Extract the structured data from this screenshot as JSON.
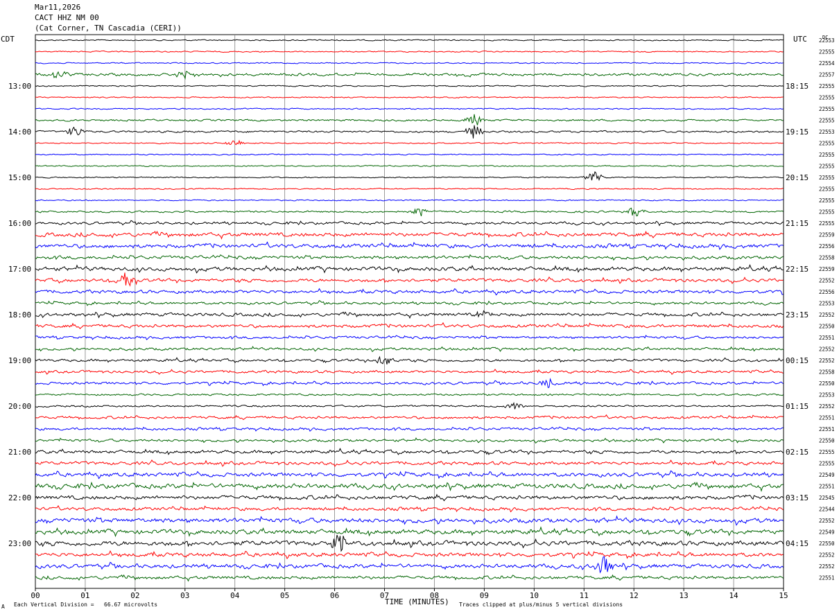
{
  "header": {
    "date": "Mar11,2026",
    "station": "CACT HHZ NM 00",
    "location": "(Cat Corner, TN Cascadia (CERI))"
  },
  "left_tz": "CDT",
  "right_tz": "UTC",
  "dc_label": "DC",
  "footer": {
    "scale": "Each Vertical Division =   66.67 microvolts",
    "xlabel": "TIME (MINUTES)",
    "clip_note": "Traces clipped at plus/minus 5 vertical divisions",
    "corner_mark": "A"
  },
  "colors": {
    "trace_cycle": [
      "#000000",
      "#ff0000",
      "#0000ff",
      "#006400"
    ],
    "grid": "#808080"
  },
  "chart_data": {
    "type": "line",
    "title": "CACT HHZ NM 00",
    "xlabel": "TIME (MINUTES)",
    "xlim": [
      0,
      15
    ],
    "x_ticks": [
      "00",
      "01",
      "02",
      "03",
      "04",
      "05",
      "06",
      "07",
      "08",
      "09",
      "10",
      "11",
      "12",
      "13",
      "14",
      "15"
    ],
    "left_hour_labels": [
      "13:00",
      "14:00",
      "15:00",
      "16:00",
      "17:00",
      "18:00",
      "19:00",
      "20:00",
      "21:00",
      "22:00",
      "23:00"
    ],
    "right_hour_labels": [
      "18:15",
      "19:15",
      "20:15",
      "21:15",
      "22:15",
      "23:15",
      "00:15",
      "01:15",
      "02:15",
      "03:15",
      "04:15"
    ],
    "dc_offsets": [
      "22553",
      "22555",
      "22554",
      "22557",
      "22555",
      "22555",
      "22555",
      "22555",
      "22553",
      "22555",
      "22555",
      "22555",
      "22555",
      "22555",
      "22555",
      "22555",
      "22555",
      "22559",
      "22556",
      "22558",
      "22559",
      "22552",
      "22556",
      "22553",
      "22552",
      "22550",
      "22551",
      "22552",
      "22552",
      "22558",
      "22550",
      "22553",
      "22552",
      "22551",
      "22551",
      "22550",
      "22555",
      "22555",
      "22549",
      "22551",
      "22545",
      "22544",
      "22552",
      "22549",
      "22550",
      "22552",
      "22552",
      "22551"
    ],
    "trace_activity": [
      1,
      1,
      1,
      3,
      1,
      1,
      1,
      2,
      2,
      1,
      1,
      1,
      1,
      1,
      1,
      2,
      3,
      5,
      5,
      4,
      5,
      4,
      4,
      3,
      4,
      4,
      3,
      3,
      3,
      3,
      3,
      2,
      2,
      3,
      3,
      3,
      4,
      4,
      5,
      6,
      5,
      4,
      6,
      6,
      6,
      5,
      5,
      4
    ],
    "events": [
      {
        "trace": 3,
        "minute": 0.5,
        "amp": 3
      },
      {
        "trace": 3,
        "minute": 3.0,
        "amp": 2.5
      },
      {
        "trace": 7,
        "minute": 8.8,
        "amp": 3
      },
      {
        "trace": 8,
        "minute": 0.8,
        "amp": 2.5
      },
      {
        "trace": 8,
        "minute": 8.8,
        "amp": 3.5
      },
      {
        "trace": 9,
        "minute": 4.0,
        "amp": 2
      },
      {
        "trace": 12,
        "minute": 11.2,
        "amp": 3
      },
      {
        "trace": 15,
        "minute": 7.7,
        "amp": 2.5
      },
      {
        "trace": 15,
        "minute": 12.0,
        "amp": 2.5
      },
      {
        "trace": 21,
        "minute": 1.8,
        "amp": 4
      },
      {
        "trace": 24,
        "minute": 9.0,
        "amp": 2
      },
      {
        "trace": 28,
        "minute": 7.0,
        "amp": 2.5
      },
      {
        "trace": 30,
        "minute": 10.3,
        "amp": 2.5
      },
      {
        "trace": 32,
        "minute": 9.6,
        "amp": 2
      },
      {
        "trace": 44,
        "minute": 6.1,
        "amp": 5
      },
      {
        "trace": 46,
        "minute": 11.4,
        "amp": 5
      }
    ]
  }
}
